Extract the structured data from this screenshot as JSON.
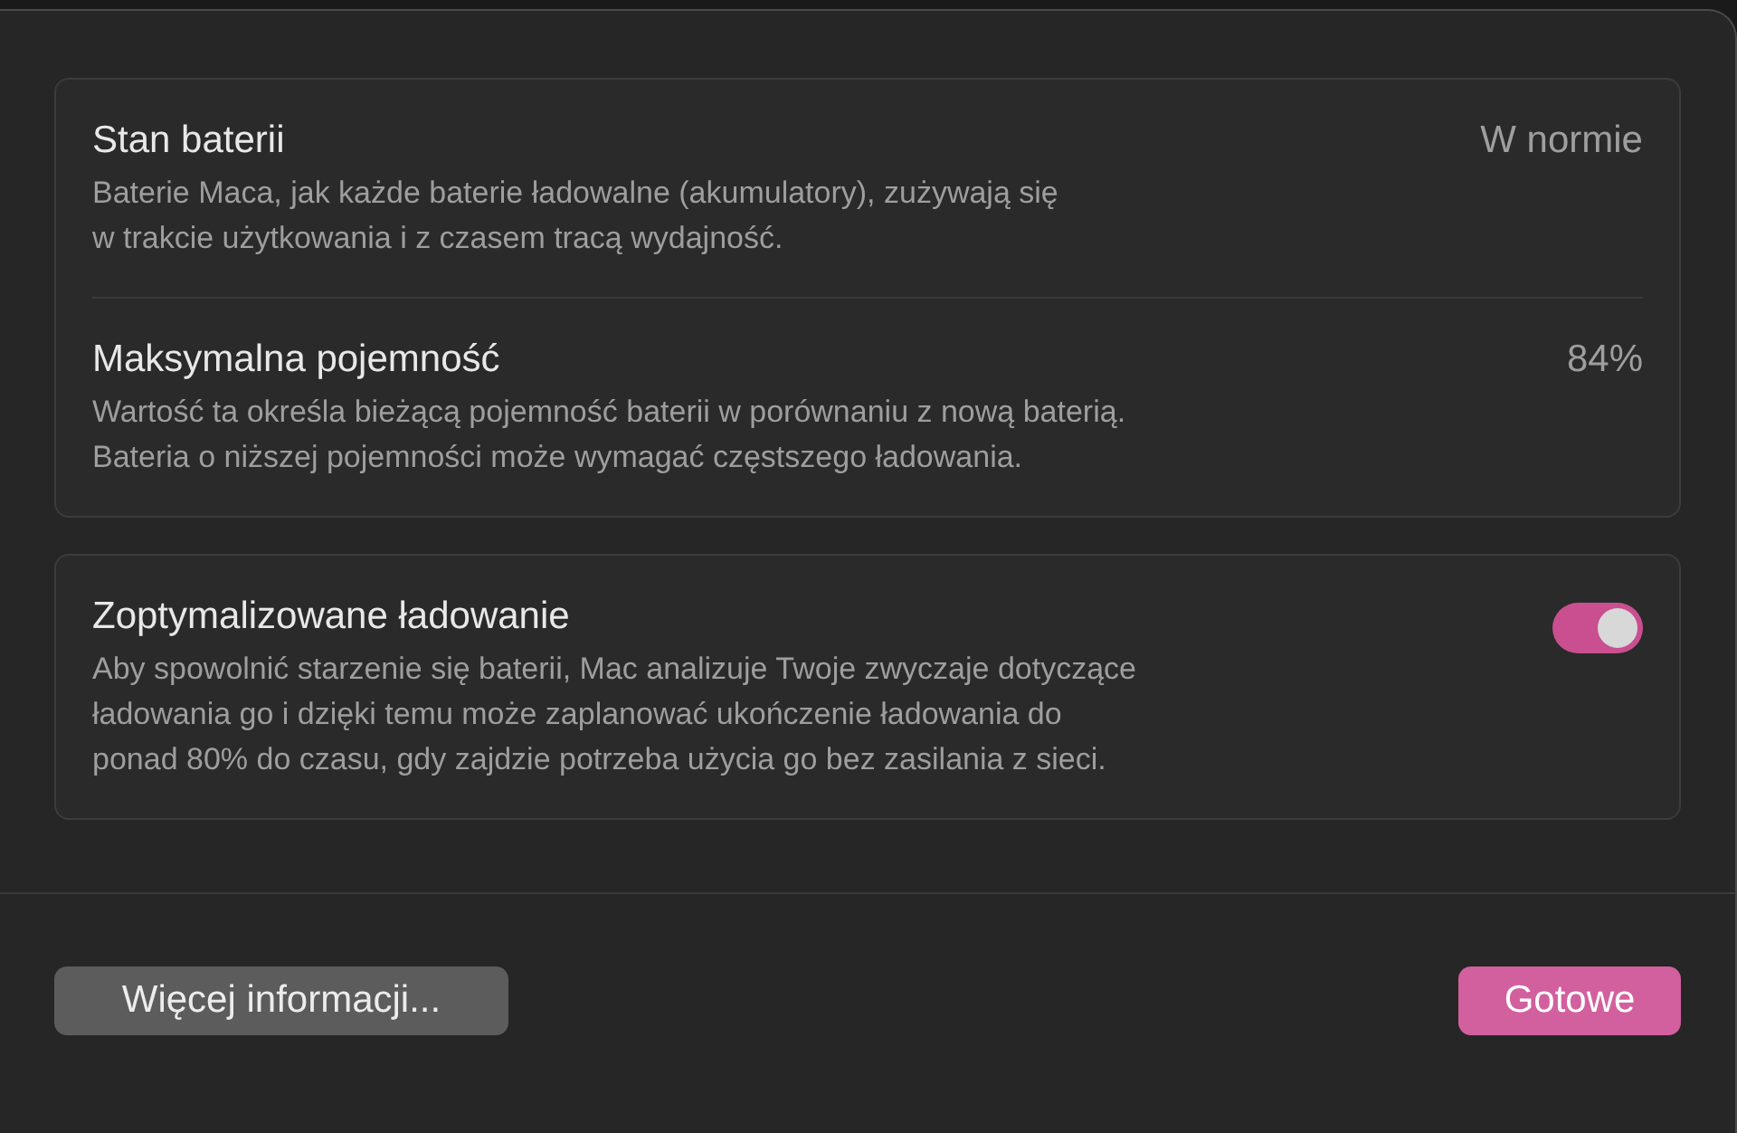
{
  "groups": [
    {
      "rows": [
        {
          "kind": "info",
          "title": "Stan baterii",
          "value": "W normie",
          "description": [
            "Baterie Maca, jak każde baterie ładowalne (akumulatory), zużywają się",
            "w trakcie użytkowania i z czasem tracą wydajność."
          ]
        },
        {
          "kind": "info",
          "title": "Maksymalna pojemność",
          "value": "84%",
          "description": [
            "Wartość ta określa bieżącą pojemność baterii w porównaniu z nową baterią.",
            "Bateria o niższej pojemności może wymagać częstszego ładowania."
          ]
        }
      ]
    },
    {
      "rows": [
        {
          "kind": "toggle",
          "title": "Zoptymalizowane ładowanie",
          "on": true,
          "description": [
            "Aby spowolnić starzenie się baterii, Mac analizuje Twoje zwyczaje dotyczące",
            "ładowania go i dzięki temu może zaplanować ukończenie ładowania do",
            "ponad 80% do czasu, gdy zajdzie potrzeba użycia go bez zasilania z sieci."
          ]
        }
      ]
    }
  ],
  "buttons": [
    {
      "kind": "default",
      "label": "Więcej informacji..."
    },
    {
      "kind": "primary",
      "label": "Gotowe"
    }
  ]
}
